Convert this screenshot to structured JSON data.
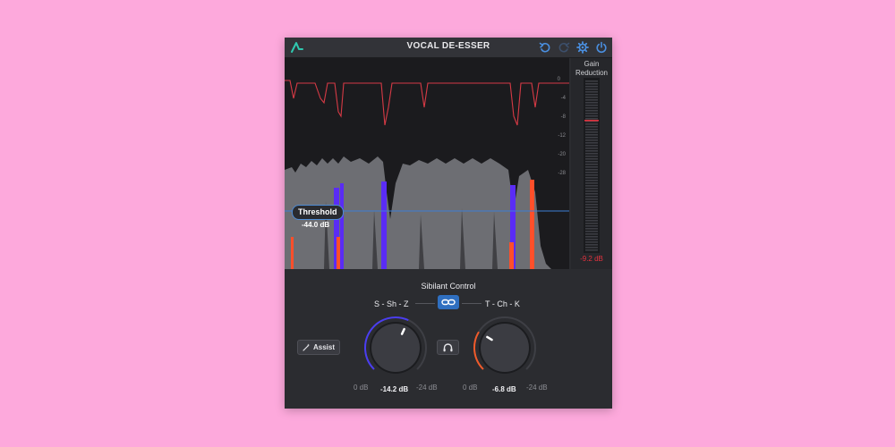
{
  "window": {
    "title": "VOCAL DE-ESSER"
  },
  "display": {
    "threshold_label": "Threshold",
    "threshold_value": "-44.0 dB",
    "threshold_db": -44.0,
    "scale_labels": [
      "0",
      "-4",
      "-8",
      "-12",
      "-20",
      "-28"
    ],
    "colors": {
      "reduction_line": "#d63a45",
      "waveform": "#6d6e73",
      "sibilance_s": "#5a2cf5",
      "sibilance_t": "#ff4f2a",
      "threshold_line": "#3d7fd6"
    }
  },
  "gain_reduction": {
    "label": "Gain Reduction",
    "value": "-9.2 dB",
    "level_db": -9.2
  },
  "controls": {
    "section_title": "Sibilant Control",
    "band_left_label": "S - Sh - Z",
    "band_right_label": "T - Ch - K",
    "link_icon": "link-icon",
    "assist_label": "Assist",
    "listen_icon": "headphones-icon",
    "knob_left": {
      "min_label": "0 dB",
      "max_label": "-24 dB",
      "value": "-14.2 dB",
      "value_db": -14.2,
      "accent": "#4a3df0"
    },
    "knob_right": {
      "min_label": "0 dB",
      "max_label": "-24 dB",
      "value": "-6.8 dB",
      "value_db": -6.8,
      "accent": "#f05a2a"
    }
  },
  "colors": {
    "background": "#fda9dc",
    "panel": "#2b2c30",
    "accent_blue": "#2f6fc0",
    "logo": "#2fc9b0",
    "meter_red": "#e2323e"
  }
}
